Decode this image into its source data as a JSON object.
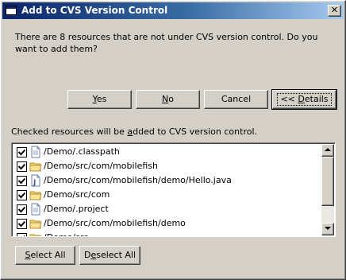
{
  "window": {
    "title": "Add to CVS Version Control",
    "close_glyph": "✕"
  },
  "message": "There are 8 resources that are not under CVS version control. Do you want to add them?",
  "buttons": {
    "yes": {
      "mnemonic": "Y",
      "rest": "es"
    },
    "no": {
      "mnemonic": "N",
      "rest": "o"
    },
    "cancel": "Cancel",
    "details": {
      "prefix": "<< ",
      "mnemonic": "D",
      "rest": "etails"
    }
  },
  "checked_label": {
    "pre": "Checked resources will be ",
    "mnemonic": "a",
    "post": "dded to CVS version control."
  },
  "resources": [
    {
      "path": "/Demo/.classpath",
      "icon": "file-icon",
      "checked": true
    },
    {
      "path": "/Demo/src/com/mobilefish",
      "icon": "folder-icon",
      "checked": true
    },
    {
      "path": "/Demo/src/com/mobilefish/demo/Hello.java",
      "icon": "java-file-icon",
      "checked": true
    },
    {
      "path": "/Demo/src/com",
      "icon": "folder-icon",
      "checked": true
    },
    {
      "path": "/Demo/.project",
      "icon": "file-icon",
      "checked": true
    },
    {
      "path": "/Demo/src/com/mobilefish/demo",
      "icon": "folder-icon",
      "checked": true
    },
    {
      "path": "/Demo/src",
      "icon": "folder-icon",
      "checked": true
    }
  ],
  "select_all": {
    "mnemonic": "S",
    "rest": "elect All"
  },
  "deselect_all": {
    "pre": "D",
    "mnemonic": "e",
    "rest": "select All"
  },
  "colors": {
    "titlebar_start": "#0a246a",
    "titlebar_end": "#a6caf0",
    "face": "#d4d0c8"
  }
}
